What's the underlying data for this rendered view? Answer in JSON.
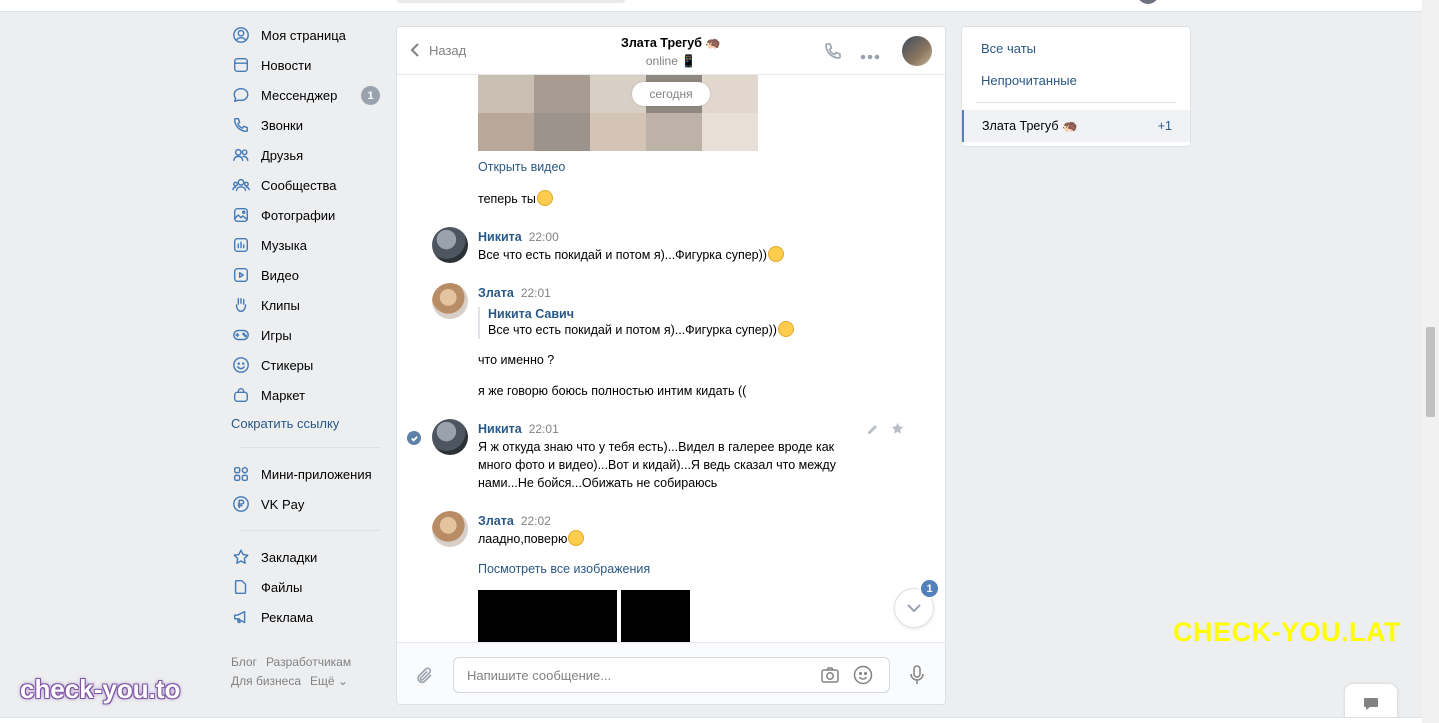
{
  "nav": {
    "items": [
      {
        "label": "Моя страница",
        "icon": "user-circle-icon"
      },
      {
        "label": "Новости",
        "icon": "news-icon"
      },
      {
        "label": "Мессенджер",
        "icon": "message-icon",
        "badge": "1"
      },
      {
        "label": "Звонки",
        "icon": "phone-icon"
      },
      {
        "label": "Друзья",
        "icon": "friends-icon"
      },
      {
        "label": "Сообщества",
        "icon": "communities-icon"
      },
      {
        "label": "Фотографии",
        "icon": "photo-icon"
      },
      {
        "label": "Музыка",
        "icon": "music-icon"
      },
      {
        "label": "Видео",
        "icon": "video-icon"
      },
      {
        "label": "Клипы",
        "icon": "clips-icon"
      },
      {
        "label": "Игры",
        "icon": "gamepad-icon"
      },
      {
        "label": "Стикеры",
        "icon": "smile-icon"
      },
      {
        "label": "Маркет",
        "icon": "bag-icon"
      }
    ],
    "shorten_link": "Сократить ссылку",
    "apps": [
      {
        "label": "Мини-приложения",
        "icon": "apps-icon"
      },
      {
        "label": "VK Pay",
        "icon": "vkpay-icon"
      }
    ],
    "extra": [
      {
        "label": "Закладки",
        "icon": "star-icon"
      },
      {
        "label": "Файлы",
        "icon": "file-icon"
      },
      {
        "label": "Реклама",
        "icon": "megaphone-icon"
      }
    ],
    "footer": [
      "Блог",
      "Разработчикам",
      "Для бизнеса",
      "Ещё ⌄"
    ]
  },
  "chat": {
    "back_label": "Назад",
    "peer_name": "Злата Трегуб 🦔",
    "peer_status": "online 📱",
    "date_pill": "сегодня",
    "open_video": "Открыть видео",
    "msg1": "теперь ты",
    "messages": [
      {
        "author": "Никита",
        "time": "22:00",
        "text": "Все что есть покидай и потом я)...Фигурка супер))"
      },
      {
        "author": "Злата",
        "time": "22:01",
        "fwd_author": "Никита Савич",
        "fwd_text": "Все что есть покидай и потом я)...Фигурка супер))",
        "text1": "что именно ?",
        "text2": "я же говорю боюсь полностью интим кидать (("
      },
      {
        "author": "Никита",
        "time": "22:01",
        "text": "Я ж откуда знаю что у тебя есть)...Видел в галерее вроде как много фото и видео)...Вот и кидай)...Я ведь сказал что между нами...Не бойся...Обижать не собираюсь"
      },
      {
        "author": "Злата",
        "time": "22:02",
        "text": "лаадно,поверю",
        "see_all": "Посмотреть все изображения"
      }
    ],
    "unread_count": "1",
    "input_placeholder": "Напишите сообщение..."
  },
  "right": {
    "all_chats": "Все чаты",
    "unread": "Непрочитанные",
    "active_chat": "Злата Трегуб 🦔",
    "active_count": "+1"
  },
  "watermarks": {
    "yellow": "CHECK-YOU.LAT",
    "purple": "check-you.to"
  },
  "colors": {
    "accent": "#2a5885",
    "icon_blue": "#447bba",
    "badge": "#99a2ad",
    "bg": "#edeef0"
  }
}
